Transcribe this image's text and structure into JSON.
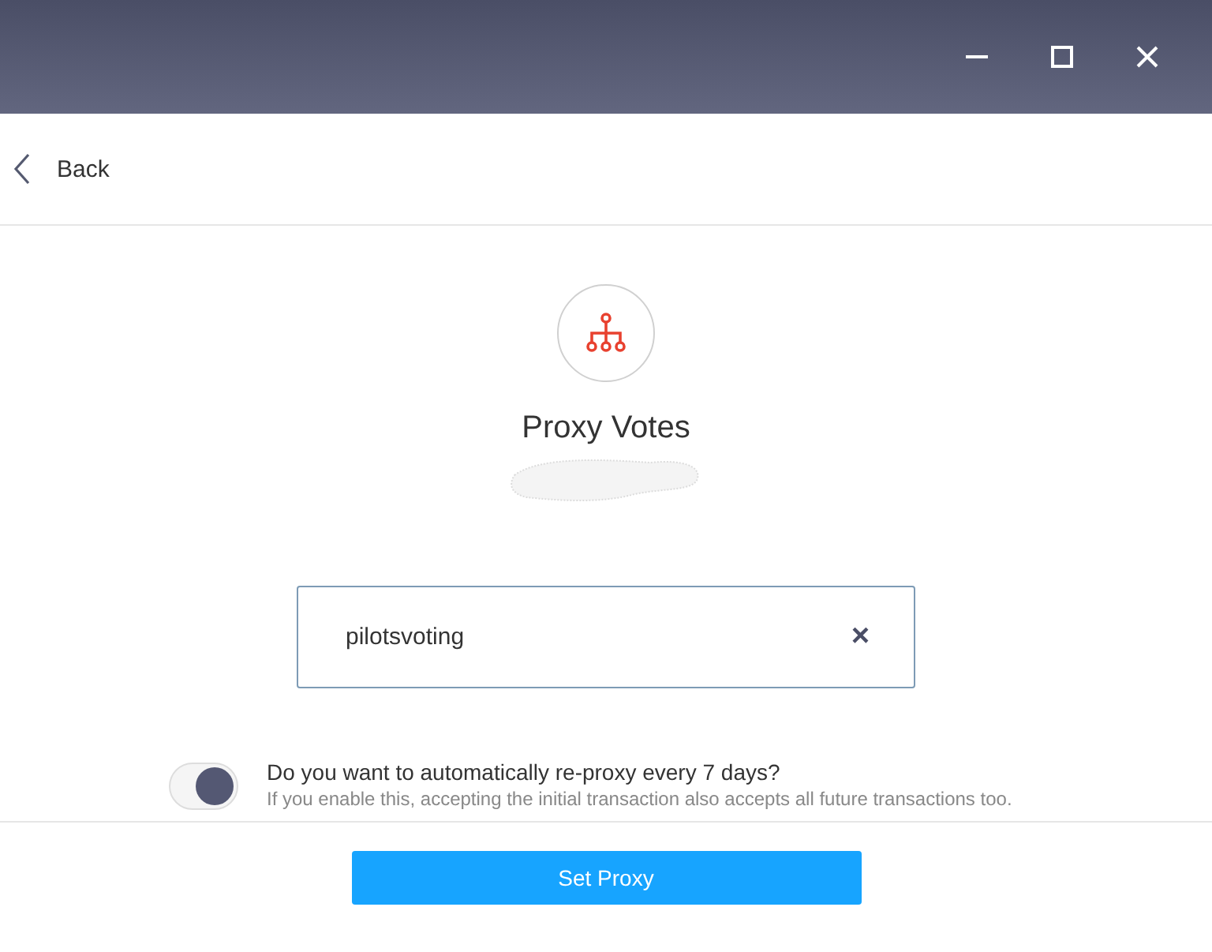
{
  "nav": {
    "back_label": "Back"
  },
  "header": {
    "title": "Proxy Votes"
  },
  "proxy_field": {
    "value": "pilotsvoting",
    "clear_icon": "×"
  },
  "auto_reproxy": {
    "on": true,
    "question": "Do you want to automatically re-proxy every 7 days?",
    "hint": "If you enable this, accepting the initial transaction also accepts all future transactions too."
  },
  "footer": {
    "button": "Set Proxy"
  }
}
